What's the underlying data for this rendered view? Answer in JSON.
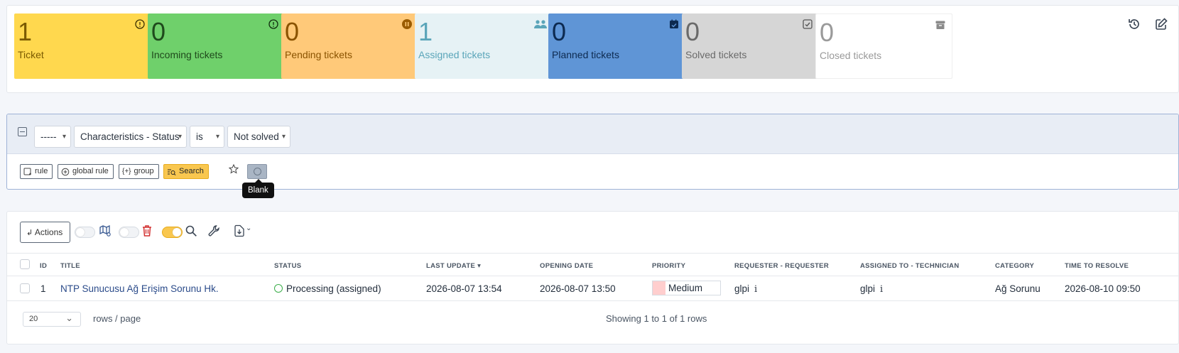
{
  "tiles": [
    {
      "count": "1",
      "label": "Ticket",
      "bg": "#ffd84e",
      "fg": "#7a5a00",
      "icon": "alert-circle-icon"
    },
    {
      "count": "0",
      "label": "Incoming tickets",
      "bg": "#6fd06b",
      "fg": "#1f4a1c",
      "icon": "alert-circle-icon"
    },
    {
      "count": "0",
      "label": "Pending tickets",
      "bg": "#ffc979",
      "fg": "#8a5300",
      "icon": "pause-circle-icon"
    },
    {
      "count": "1",
      "label": "Assigned tickets",
      "bg": "#e6f2f5",
      "fg": "#5aa5b9",
      "icon": "users-icon"
    },
    {
      "count": "0",
      "label": "Planned tickets",
      "bg": "#5f95d6",
      "fg": "#0d2a50",
      "icon": "calendar-check-icon"
    },
    {
      "count": "0",
      "label": "Solved tickets",
      "bg": "#d6d6d6",
      "fg": "#6a6a6a",
      "icon": "square-check-icon"
    },
    {
      "count": "0",
      "label": "Closed tickets",
      "bg": "#ffffff",
      "fg": "#9a9a9a",
      "icon": "archive-icon"
    }
  ],
  "criteria": {
    "link": "-----",
    "field": "Characteristics - Status",
    "operator": "is",
    "value": "Not solved"
  },
  "search_buttons": {
    "rule": "rule",
    "global_rule": "global rule",
    "group": "group",
    "search": "Search"
  },
  "tooltip": "Blank",
  "toolbar": {
    "actions": "Actions"
  },
  "columns": [
    "ID",
    "TITLE",
    "STATUS",
    "LAST UPDATE",
    "OPENING DATE",
    "PRIORITY",
    "REQUESTER - REQUESTER",
    "ASSIGNED TO - TECHNICIAN",
    "CATEGORY",
    "TIME TO RESOLVE"
  ],
  "rows": [
    {
      "id": "1",
      "title": "NTP Sunucusu Ağ Erişim Sorunu Hk.",
      "status": "Processing (assigned)",
      "last_update": "2026-08-07 13:54",
      "opening_date": "2026-08-07 13:50",
      "priority": "Medium",
      "requester": "glpi",
      "technician": "glpi",
      "category": "Ağ Sorunu",
      "time_to_resolve": "2026-08-10 09:50"
    }
  ],
  "pagination": {
    "rows_per_page": "20",
    "rows_label": "rows / page",
    "showing": "Showing 1 to 1 of 1 rows"
  }
}
